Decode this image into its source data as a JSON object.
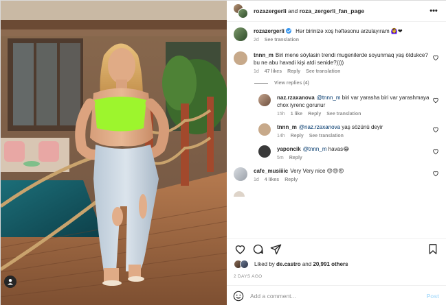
{
  "header": {
    "author": "rozazergerli",
    "conjunction": "and",
    "coauthor": "roza_zergerli_fan_page",
    "more_icon": "more-horizontal-icon"
  },
  "caption": {
    "user": "rozazergerli",
    "text": "Hər birinizə xoş həftəsonu arzulayıram 🙆‍♀️❤",
    "age": "2d",
    "see_translation": "See translation"
  },
  "comments": [
    {
      "user": "tnnn_m",
      "text": "Biri mene söylasin trendi mugenilerde soyunmaq yaş ötdukce?bu ne abu havadi kişi atdi senide?))))",
      "age": "1d",
      "likes": "47 likes",
      "reply": "Reply",
      "see_translation": "See translation",
      "avatar_color": "#c7a98a"
    },
    {
      "user": "cafe_musiiiic",
      "text": "Very Very nice 😍😍😍",
      "age": "1d",
      "likes": "4 likes",
      "reply": "Reply",
      "avatar_color": "#bfc3c9"
    }
  ],
  "view_replies": "View replies (4)",
  "replies": [
    {
      "user": "naz.rzaxanova",
      "mention": "@tnnn_m",
      "text": "biri var yarasha biri var yarashmaya chox iyrenc gorunur",
      "age": "15h",
      "likes": "1 like",
      "reply": "Reply",
      "see_translation": "See translation",
      "avatar_color": "#a88b77"
    },
    {
      "user": "tnnn_m",
      "mention": "@naz.rzaxanova",
      "text": "yaş sözünü deyir",
      "age": "14h",
      "reply": "Reply",
      "see_translation": "See translation",
      "avatar_color": "#c7a98a"
    },
    {
      "user": "yaponcik",
      "mention": "@tnnn_m",
      "text": "havas😂",
      "age": "5m",
      "reply": "Reply",
      "avatar_color": "#3a3a3a"
    }
  ],
  "actions": {
    "like_icon": "heart-icon",
    "comment_icon": "comment-bubble-icon",
    "share_icon": "paper-plane-icon",
    "save_icon": "bookmark-icon"
  },
  "likes": {
    "prefix": "Liked by",
    "user": "de.castro",
    "middle": "and",
    "count": "20,991 others"
  },
  "timestamp": "2 DAYS AGO",
  "add_comment": {
    "placeholder": "Add a comment...",
    "post_label": "Post",
    "emoji_icon": "smiley-icon"
  },
  "photo": {
    "tag_icon": "user-tag-icon"
  }
}
